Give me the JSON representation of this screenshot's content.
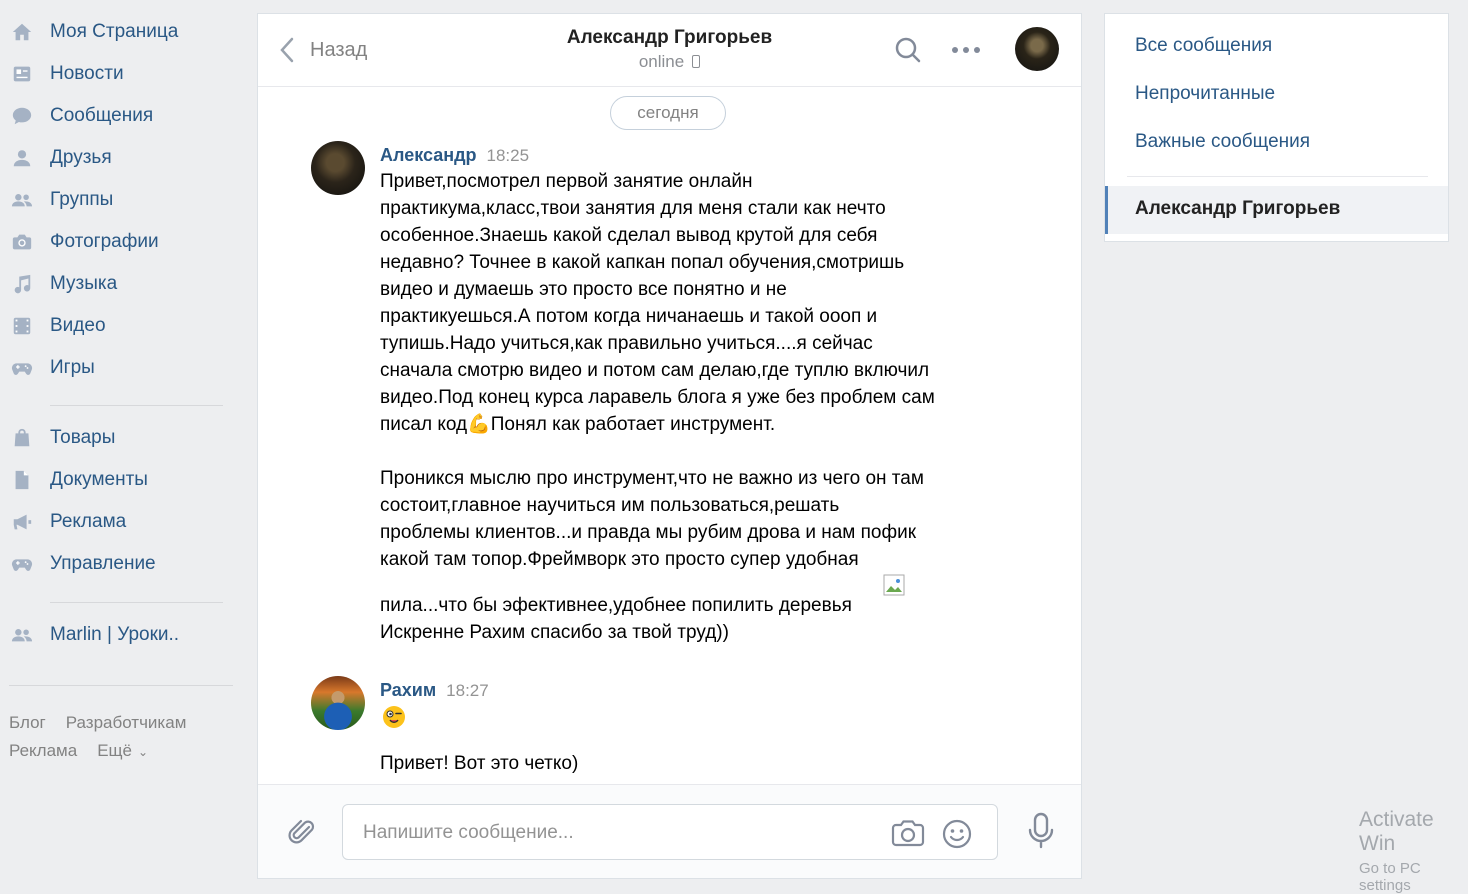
{
  "nav": {
    "items": [
      {
        "label": "Моя Страница",
        "icon": "home-icon"
      },
      {
        "label": "Новости",
        "icon": "news-icon"
      },
      {
        "label": "Сообщения",
        "icon": "messages-icon"
      },
      {
        "label": "Друзья",
        "icon": "friends-icon"
      },
      {
        "label": "Группы",
        "icon": "groups-icon"
      },
      {
        "label": "Фотографии",
        "icon": "camera-icon"
      },
      {
        "label": "Музыка",
        "icon": "music-icon"
      },
      {
        "label": "Видео",
        "icon": "video-icon"
      },
      {
        "label": "Игры",
        "icon": "gamepad-icon"
      },
      {
        "label": "Товары",
        "icon": "shopping-bag-icon"
      },
      {
        "label": "Документы",
        "icon": "document-icon"
      },
      {
        "label": "Реклама",
        "icon": "megaphone-icon"
      },
      {
        "label": "Управление",
        "icon": "gamepad-icon"
      },
      {
        "label": "Marlin | Уроки..",
        "icon": "groups-icon"
      }
    ],
    "footer": {
      "blog": "Блог",
      "developers": "Разработчикам",
      "ads": "Реклама",
      "more": "Ещё"
    }
  },
  "chat": {
    "back_label": "Назад",
    "peer_name": "Александр Григорьев",
    "peer_status": "online",
    "date_divider": "сегодня",
    "messages": [
      {
        "author": "Александр",
        "time": "18:25",
        "text_part1": "Привет,посмотрел первой занятие онлайн\nпрактикума,класс,твои занятия для меня стали как нечто\nособенное.Знаешь какой сделал вывод крутой для себя\nнедавно? Точнее в какой капкан попал обучения,смотришь\nвидео и думаешь это просто все понятно и не\nпрактикуешься.А потом когда ничанаешь и такой оооп и\nтупишь.Надо учиться,как правильно учиться....я сейчас\nсначала смотрю видео и потом сам делаю,где туплю включил\nвидео.Под конец курса ларавель блога я уже без проблем сам\nписал код💪Понял как работает инструмент.\n\nПроникся мыслю про инструмент,что не важно из чего он там\nсостоит,главное научиться им пользоваться,решать\nпроблемы клиентов...и правда мы рубим дрова и нам пофик\nкакой там топор.Фреймворк это просто супер удобная",
        "text_part2": "пила...что бы эфективнее,удобнее попилить деревья\nИскренне Рахим спасибо за твой труд))"
      },
      {
        "author": "Рахим",
        "time": "18:27",
        "text": "Привет! Вот это четко)"
      }
    ],
    "composer_placeholder": "Напишите сообщение..."
  },
  "right_panel": {
    "filters": [
      "Все сообщения",
      "Непрочитанные",
      "Важные сообщения"
    ],
    "active_conversation": "Александр Григорьев"
  },
  "watermark": {
    "line1": "Activate Win",
    "line2": "Go to PC settings"
  },
  "colors": {
    "link": "#2a5885",
    "accent": "#5181b8",
    "background": "#edeef0"
  }
}
